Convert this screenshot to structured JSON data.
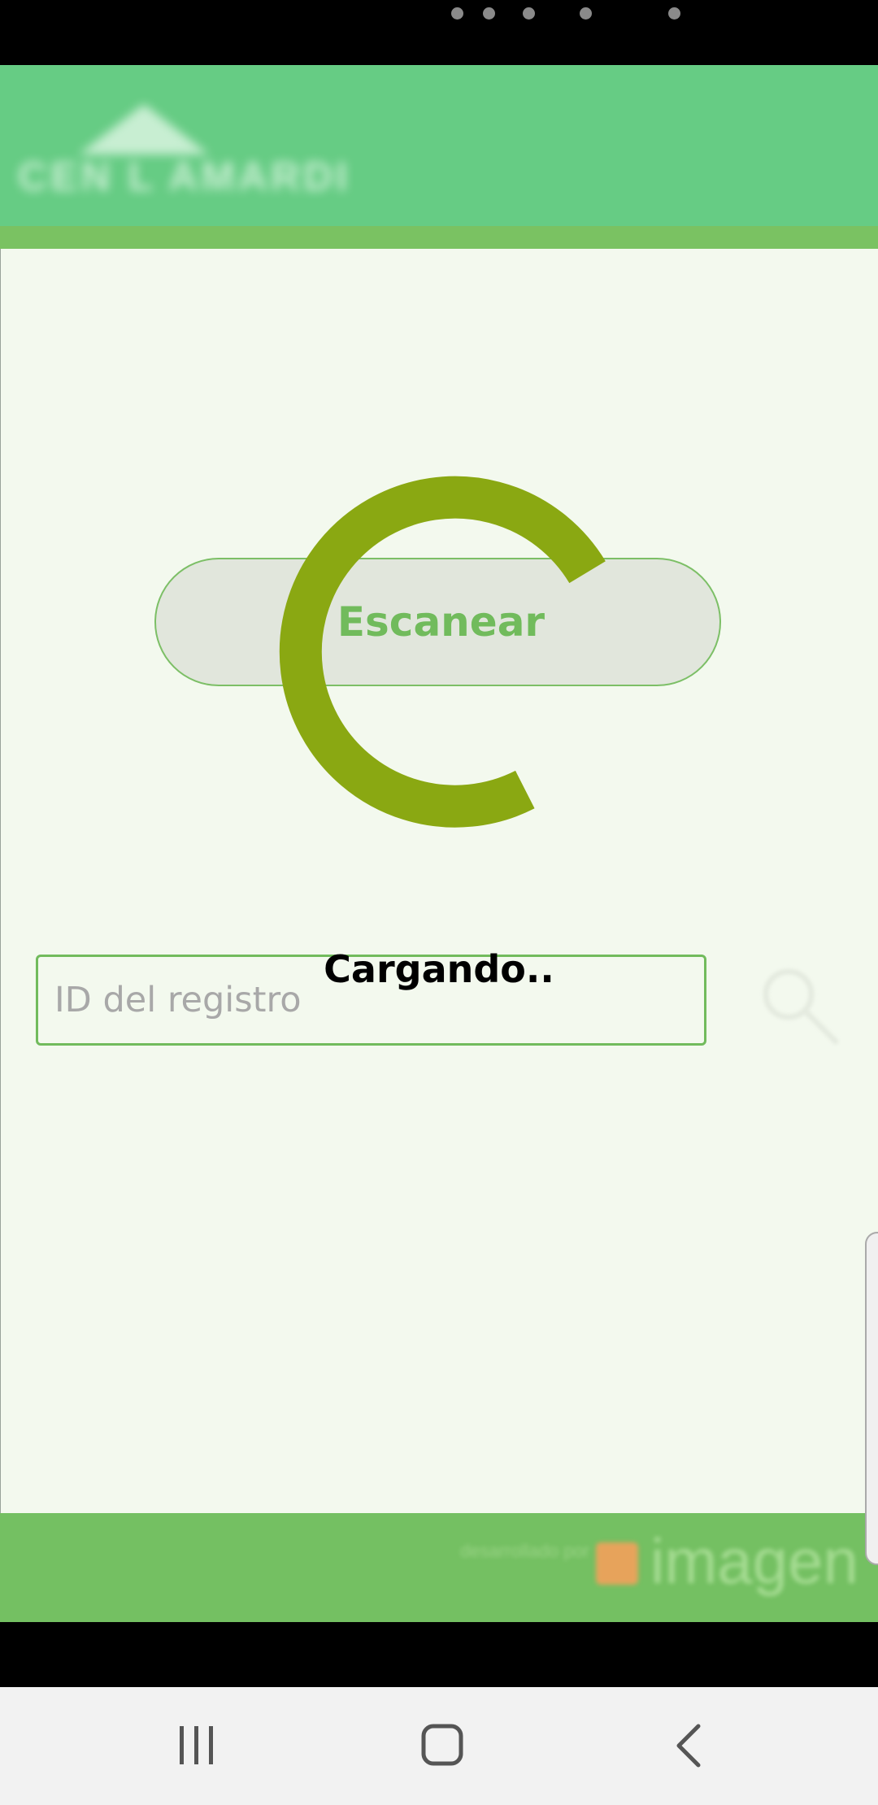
{
  "app": {
    "logo_text": "CEN L AMARDI",
    "scan_button_label": "Escanear",
    "record_id_placeholder": "ID del registro",
    "record_id_value": "",
    "loading_text": "Cargando..",
    "footer_credit_small": "desarrollado por",
    "footer_credit_brand": "imagen"
  },
  "icons": {
    "search": "search-icon",
    "spinner": "loading-spinner-icon",
    "recents": "recent-apps-icon",
    "home": "home-icon",
    "back": "back-icon"
  },
  "colors": {
    "header_green": "#66cc84",
    "accent_green": "#71bb5c",
    "spinner_olive": "#8aa812",
    "content_bg": "#f3f9ee"
  }
}
